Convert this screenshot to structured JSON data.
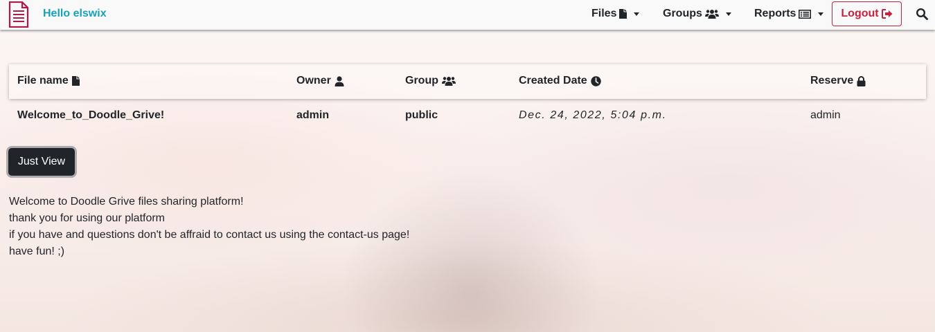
{
  "navbar": {
    "brand_icon": "document-icon",
    "greeting": "Hello elswix",
    "menu": [
      {
        "label": "Files",
        "icon": "file-icon"
      },
      {
        "label": "Groups",
        "icon": "users-icon"
      },
      {
        "label": "Reports",
        "icon": "list-icon"
      }
    ],
    "logout_label": "Logout",
    "logout_icon": "sign-out-icon",
    "search_icon": "search-icon",
    "colors": {
      "greeting": "#17a2b8",
      "logout": "#c9213c"
    }
  },
  "table": {
    "headers": [
      {
        "label": "File name",
        "icon": "file-icon"
      },
      {
        "label": "Owner",
        "icon": "user-icon"
      },
      {
        "label": "Group",
        "icon": "users-icon"
      },
      {
        "label": "Created Date",
        "icon": "clock-icon"
      },
      {
        "label": "Reserve",
        "icon": "lock-icon"
      }
    ],
    "rows": [
      {
        "file_name": "Welcome_to_Doodle_Grive!",
        "owner": "admin",
        "group": "public",
        "created_date": "Dec. 24, 2022, 5:04 p.m.",
        "reserve": "admin"
      }
    ]
  },
  "actions": {
    "just_view_label": "Just View"
  },
  "content": {
    "lines": [
      "Welcome to Doodle Grive files sharing platform!",
      "thank you for using our platform",
      "if you have and questions don't be affraid to contact us using the contact-us page!",
      "have fun! ;)"
    ]
  }
}
